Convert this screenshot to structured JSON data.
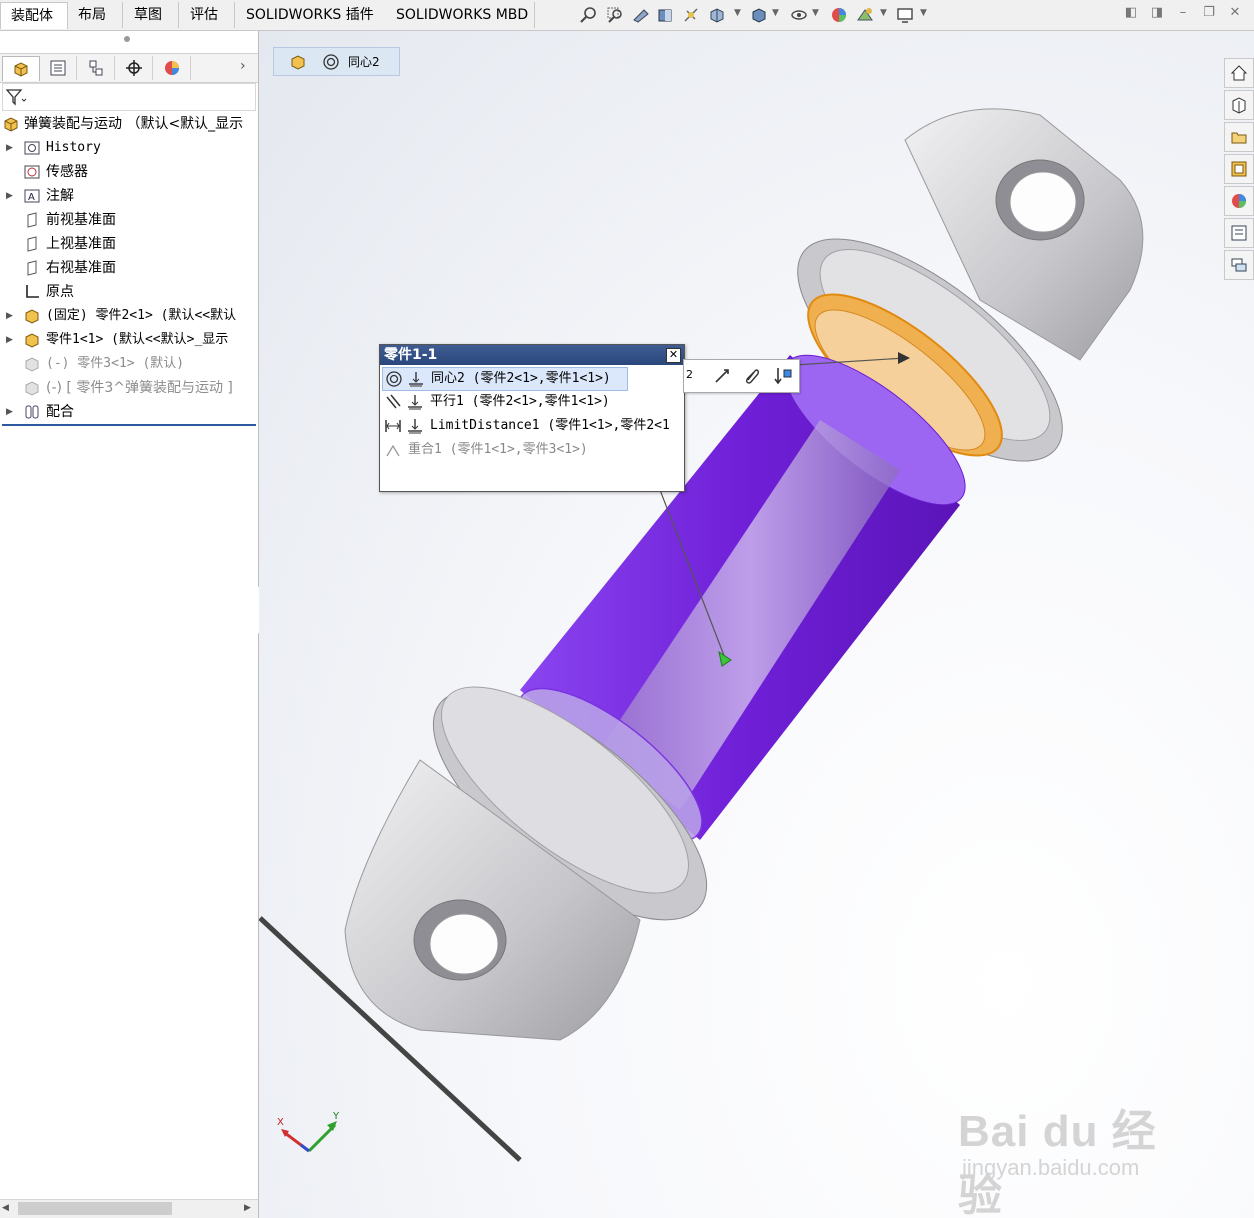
{
  "top_tabs": [
    "装配体",
    "布局",
    "草图",
    "评估",
    "SOLIDWORKS 插件",
    "SOLIDWORKS MBD"
  ],
  "active_tab_index": 0,
  "feature_tree": {
    "root_label": "弹簧装配与运动 （默认<默认_显示",
    "items": [
      {
        "label": "History",
        "icon": "history-icon",
        "expandable": true,
        "dim": false
      },
      {
        "label": "传感器",
        "icon": "sensor-icon",
        "expandable": false,
        "dim": false
      },
      {
        "label": "注解",
        "icon": "annotation-icon",
        "expandable": true,
        "dim": false
      },
      {
        "label": "前视基准面",
        "icon": "plane-icon",
        "expandable": false,
        "dim": false
      },
      {
        "label": "上视基准面",
        "icon": "plane-icon",
        "expandable": false,
        "dim": false
      },
      {
        "label": "右视基准面",
        "icon": "plane-icon",
        "expandable": false,
        "dim": false
      },
      {
        "label": "原点",
        "icon": "origin-icon",
        "expandable": false,
        "dim": false
      },
      {
        "label": "(固定) 零件2<1> (默认<<默认",
        "icon": "part-icon",
        "expandable": true,
        "dim": false
      },
      {
        "label": "零件1<1> (默认<<默认>_显示",
        "icon": "part-icon",
        "expandable": true,
        "dim": false
      },
      {
        "label": "(-) 零件3<1> (默认)",
        "icon": "part-suppressed-icon",
        "expandable": false,
        "dim": true
      },
      {
        "label": "(-) [ 零件3^弹簧装配与运动 ]",
        "icon": "part-suppressed-icon",
        "expandable": false,
        "dim": true
      },
      {
        "label": "配合",
        "icon": "mates-icon",
        "expandable": true,
        "dim": false
      }
    ]
  },
  "breadcrumb": {
    "label": "同心2"
  },
  "popup": {
    "title": "零件1-1",
    "close_label": "✕",
    "mates": [
      {
        "label": "同心2 (零件2<1>,零件1<1>)",
        "type": "concentric-mate-icon",
        "selected": true,
        "dim": false
      },
      {
        "label": "平行1 (零件2<1>,零件1<1>)",
        "type": "parallel-mate-icon",
        "selected": false,
        "dim": false
      },
      {
        "label": "LimitDistance1 (零件1<1>,零件2<1",
        "type": "limit-distance-mate-icon",
        "selected": false,
        "dim": false
      },
      {
        "label": "重合1 (零件1<1>,零件3<1>)",
        "type": "coincident-mate-icon",
        "selected": false,
        "dim": true
      }
    ]
  },
  "context_bar": {
    "partial_label": "2"
  },
  "triad": {
    "x_label": "X",
    "y_label": "Y"
  },
  "watermark": {
    "brand": "Bai du 经验",
    "url": "jingyan.baidu.com"
  },
  "colors": {
    "selected_face": "#7b2fe0",
    "highlight_edge": "#f0a030",
    "part_gray": "#bdbdbd",
    "title_bar": "#2f4c80"
  }
}
